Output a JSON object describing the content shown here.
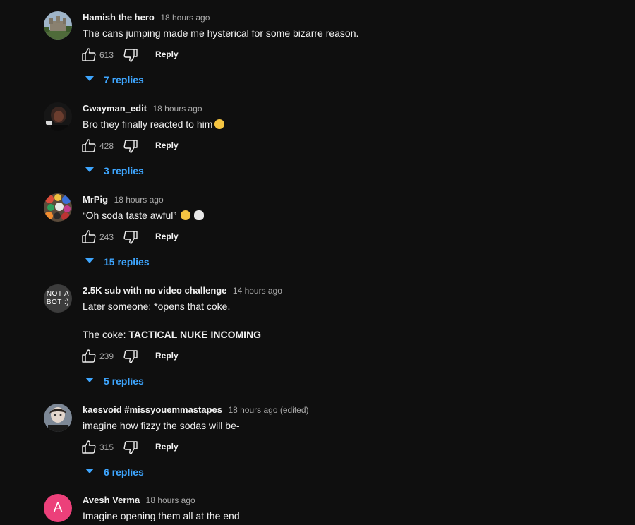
{
  "comments": [
    {
      "author": "Hamish the hero",
      "time": "18 hours ago",
      "text": "The cans jumping made me hysterical for some bizarre reason.",
      "likes": "613",
      "reply_label": "Reply",
      "replies_label": "7 replies",
      "avatar_icon": "castle-photo-avatar"
    },
    {
      "author": "Cwayman_edit",
      "time": "18 hours ago",
      "text": "Bro they finally reacted to him",
      "emoji": "sweat-smile-emoji",
      "likes": "428",
      "reply_label": "Reply",
      "replies_label": "3 replies",
      "avatar_icon": "dark-portrait-avatar"
    },
    {
      "author": "MrPig",
      "time": "18 hours ago",
      "text": "“Oh soda taste awful”",
      "emojis": [
        "rofl-emoji",
        "skull-emoji"
      ],
      "likes": "243",
      "reply_label": "Reply",
      "replies_label": "15 replies",
      "avatar_icon": "collage-avatar"
    },
    {
      "author": "2.5K sub with no video challenge",
      "time": "14 hours ago",
      "text_line1": "Later someone: *opens that coke.",
      "text_line2_prefix": "The coke: ",
      "text_line2_bold": "TACTICAL NUKE INCOMING",
      "likes": "239",
      "reply_label": "Reply",
      "replies_label": "5 replies",
      "avatar_line1": "NOT A",
      "avatar_line2": "BOT :)"
    },
    {
      "author": "kaesvoid #missyouemmastapes",
      "time": "18 hours ago (edited)",
      "text": "imagine how fizzy the sodas will be-",
      "likes": "315",
      "reply_label": "Reply",
      "replies_label": "6 replies",
      "avatar_icon": "person-photo-avatar"
    },
    {
      "author": "Avesh Verma",
      "time": "18 hours ago",
      "text": "Imagine opening them all at the end",
      "avatar_letter": "A",
      "avatar_color": "#ec407a"
    }
  ],
  "colors": {
    "background": "#0f0f0f",
    "link": "#3ea6ff",
    "secondary_text": "#aaaaaa"
  }
}
